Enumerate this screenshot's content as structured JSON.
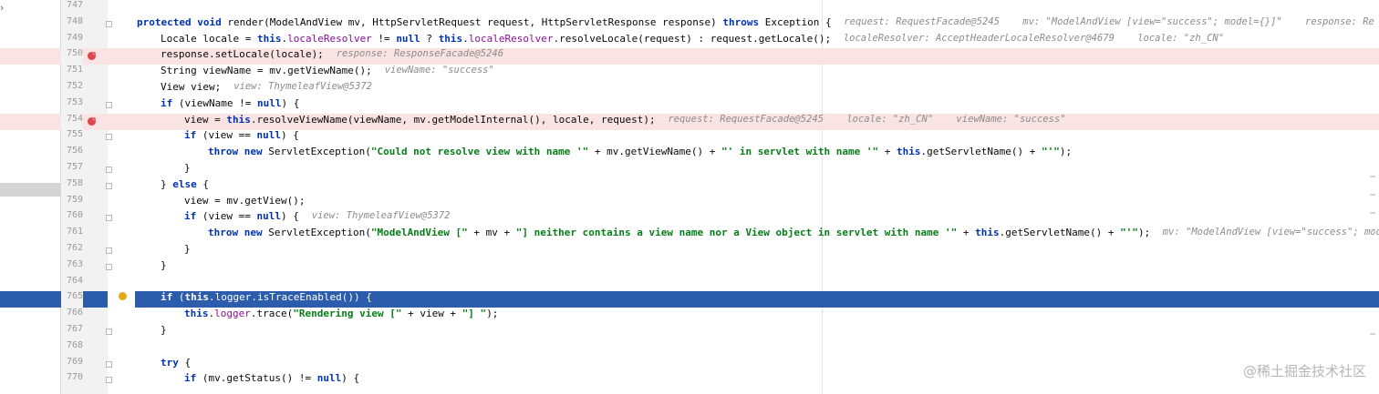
{
  "left_panel": {
    "chevron": "›"
  },
  "lines": [
    {
      "num": "747",
      "indent": 0,
      "segs": [],
      "hint": "",
      "state": "",
      "fold": false
    },
    {
      "num": "748",
      "indent": 0,
      "segs": [
        [
          "k",
          "protected void "
        ],
        [
          "",
          "render(ModelAndView mv, HttpServletRequest request, HttpServletResponse response) "
        ],
        [
          "k",
          "throws "
        ],
        [
          "",
          "Exception {"
        ]
      ],
      "hint": "request: RequestFacade@5245    mv: \"ModelAndView [view=\"success\"; model={}]\"    response: Re",
      "state": "",
      "fold": true
    },
    {
      "num": "749",
      "indent": 1,
      "segs": [
        [
          "",
          "Locale locale = "
        ],
        [
          "k",
          "this"
        ],
        [
          "",
          "."
        ],
        [
          "f",
          "localeResolver"
        ],
        [
          "",
          " != "
        ],
        [
          "k",
          "null"
        ],
        [
          "",
          " ? "
        ],
        [
          "k",
          "this"
        ],
        [
          "",
          "."
        ],
        [
          "f",
          "localeResolver"
        ],
        [
          "",
          ".resolveLocale(request) : request.getLocale();"
        ]
      ],
      "hint": "localeResolver: AcceptHeaderLocaleResolver@4679    locale: \"zh_CN\"",
      "state": "",
      "fold": false
    },
    {
      "num": "750",
      "indent": 1,
      "segs": [
        [
          "",
          "response.setLocale(locale);"
        ]
      ],
      "hint": "response: ResponseFacade@5246",
      "state": "bp",
      "fold": false
    },
    {
      "num": "751",
      "indent": 1,
      "segs": [
        [
          "",
          "String viewName = mv.getViewName();"
        ]
      ],
      "hint": "viewName: \"success\"",
      "state": "",
      "fold": false
    },
    {
      "num": "752",
      "indent": 1,
      "segs": [
        [
          "",
          "View view;"
        ]
      ],
      "hint": "view: ThymeleafView@5372",
      "state": "",
      "fold": false
    },
    {
      "num": "753",
      "indent": 1,
      "segs": [
        [
          "k",
          "if "
        ],
        [
          "",
          "(viewName != "
        ],
        [
          "k",
          "null"
        ],
        [
          "",
          ") {"
        ]
      ],
      "hint": "",
      "state": "",
      "fold": true
    },
    {
      "num": "754",
      "indent": 2,
      "segs": [
        [
          "",
          "view = "
        ],
        [
          "k",
          "this"
        ],
        [
          "",
          ".resolveViewName(viewName, mv.getModelInternal(), locale, request);"
        ]
      ],
      "hint": "request: RequestFacade@5245    locale: \"zh_CN\"    viewName: \"success\"",
      "state": "bp",
      "fold": false
    },
    {
      "num": "755",
      "indent": 2,
      "segs": [
        [
          "k",
          "if "
        ],
        [
          "",
          "(view == "
        ],
        [
          "k",
          "null"
        ],
        [
          "",
          ") {"
        ]
      ],
      "hint": "",
      "state": "",
      "fold": true
    },
    {
      "num": "756",
      "indent": 3,
      "segs": [
        [
          "k",
          "throw new "
        ],
        [
          "",
          "ServletException("
        ],
        [
          "s",
          "\"Could not resolve view with name '\""
        ],
        [
          "",
          " + mv.getViewName() + "
        ],
        [
          "s",
          "\"' in servlet with name '\""
        ],
        [
          "",
          " + "
        ],
        [
          "k",
          "this"
        ],
        [
          "",
          ".getServletName() + "
        ],
        [
          "s",
          "\"'\""
        ],
        [
          "",
          ");"
        ]
      ],
      "hint": "",
      "state": "",
      "fold": false
    },
    {
      "num": "757",
      "indent": 2,
      "segs": [
        [
          "",
          "}"
        ]
      ],
      "hint": "",
      "state": "",
      "fold": true
    },
    {
      "num": "758",
      "indent": 1,
      "segs": [
        [
          "",
          "} "
        ],
        [
          "k",
          "else "
        ],
        [
          "",
          "{"
        ]
      ],
      "hint": "",
      "state": "",
      "fold": true
    },
    {
      "num": "759",
      "indent": 2,
      "segs": [
        [
          "",
          "view = mv.getView();"
        ]
      ],
      "hint": "",
      "state": "",
      "fold": false
    },
    {
      "num": "760",
      "indent": 2,
      "segs": [
        [
          "k",
          "if "
        ],
        [
          "",
          "(view == "
        ],
        [
          "k",
          "null"
        ],
        [
          "",
          ") {"
        ]
      ],
      "hint": "view: ThymeleafView@5372",
      "state": "",
      "fold": true
    },
    {
      "num": "761",
      "indent": 3,
      "segs": [
        [
          "k",
          "throw new "
        ],
        [
          "",
          "ServletException("
        ],
        [
          "s",
          "\"ModelAndView [\""
        ],
        [
          "",
          " + mv + "
        ],
        [
          "s",
          "\"] neither contains a view name nor a View object in servlet with name '\""
        ],
        [
          "",
          " + "
        ],
        [
          "k",
          "this"
        ],
        [
          "",
          ".getServletName() + "
        ],
        [
          "s",
          "\"'\""
        ],
        [
          "",
          ");"
        ]
      ],
      "hint": "mv: \"ModelAndView [view=\"success\"; mode",
      "state": "",
      "fold": false
    },
    {
      "num": "762",
      "indent": 2,
      "segs": [
        [
          "",
          "}"
        ]
      ],
      "hint": "",
      "state": "",
      "fold": true
    },
    {
      "num": "763",
      "indent": 1,
      "segs": [
        [
          "",
          "}"
        ]
      ],
      "hint": "",
      "state": "",
      "fold": true
    },
    {
      "num": "764",
      "indent": 0,
      "segs": [],
      "hint": "",
      "state": "",
      "fold": false
    },
    {
      "num": "765",
      "indent": 1,
      "segs": [
        [
          "k",
          "if "
        ],
        [
          "",
          "("
        ],
        [
          "k",
          "this"
        ],
        [
          "",
          "."
        ],
        [
          "f",
          "logger"
        ],
        [
          "",
          ".isTraceEnabled()) {"
        ]
      ],
      "hint": "",
      "state": "cur",
      "fold": false
    },
    {
      "num": "766",
      "indent": 2,
      "segs": [
        [
          "k",
          "this"
        ],
        [
          "",
          "."
        ],
        [
          "f",
          "logger"
        ],
        [
          "",
          ".trace("
        ],
        [
          "s",
          "\"Rendering view [\""
        ],
        [
          "",
          " + view + "
        ],
        [
          "s",
          "\"] \""
        ],
        [
          "",
          ");"
        ]
      ],
      "hint": "",
      "state": "",
      "fold": false
    },
    {
      "num": "767",
      "indent": 1,
      "segs": [
        [
          "",
          "}"
        ]
      ],
      "hint": "",
      "state": "",
      "fold": true
    },
    {
      "num": "768",
      "indent": 0,
      "segs": [],
      "hint": "",
      "state": "",
      "fold": false
    },
    {
      "num": "769",
      "indent": 1,
      "segs": [
        [
          "k",
          "try "
        ],
        [
          "",
          "{"
        ]
      ],
      "hint": "",
      "state": "",
      "fold": true
    },
    {
      "num": "770",
      "indent": 2,
      "segs": [
        [
          "k",
          "if "
        ],
        [
          "",
          "(mv.getStatus() != "
        ],
        [
          "k",
          "null"
        ],
        [
          "",
          ") {"
        ]
      ],
      "hint": "",
      "state": "",
      "fold": true
    }
  ],
  "watermark": "@稀土掘金技术社区"
}
